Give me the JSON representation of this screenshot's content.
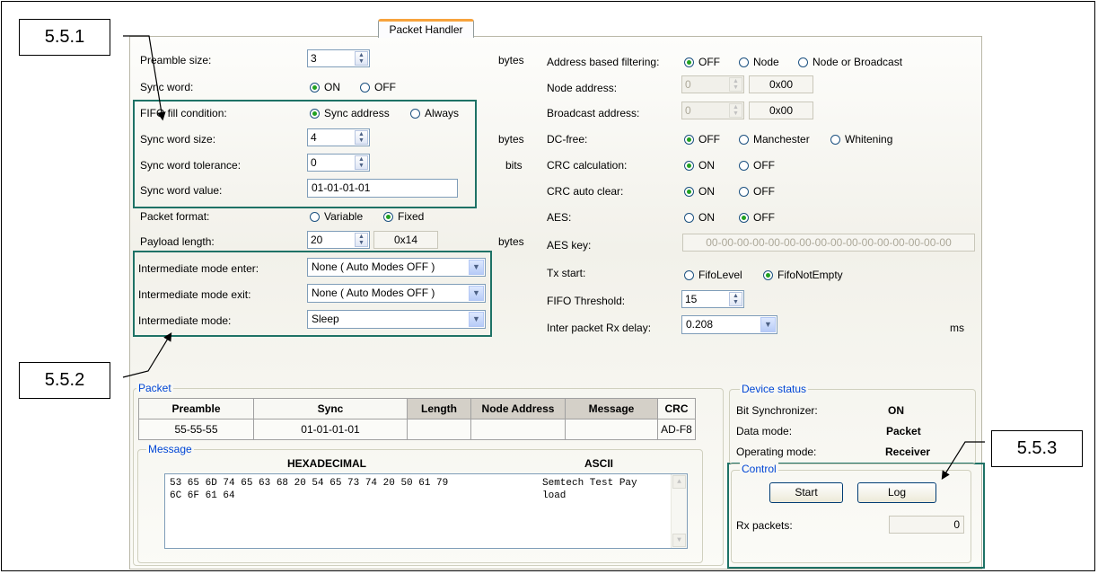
{
  "tab_label": "Packet Handler",
  "callouts": [
    "5.5.1",
    "5.5.2",
    "5.5.3"
  ],
  "left": {
    "preamble_size": {
      "label": "Preamble size:",
      "value": "3",
      "unit": "bytes"
    },
    "sync_word": {
      "label": "Sync word:",
      "on": "ON",
      "off": "OFF",
      "selected": "on"
    },
    "fifo_fill": {
      "label": "FIFO fill condition:",
      "opt1": "Sync address",
      "opt2": "Always"
    },
    "sync_word_size": {
      "label": "Sync word size:",
      "value": "4",
      "unit": "bytes"
    },
    "sync_word_tolerance": {
      "label": "Sync word tolerance:",
      "value": "0",
      "unit": "bits"
    },
    "sync_word_value": {
      "label": "Sync word value:",
      "value": "01-01-01-01"
    },
    "packet_format": {
      "label": "Packet format:",
      "opt1": "Variable",
      "opt2": "Fixed"
    },
    "payload_length": {
      "label": "Payload length:",
      "value": "20",
      "hex": "0x14",
      "unit": "bytes"
    },
    "im_enter": {
      "label": "Intermediate mode enter:",
      "value": "None ( Auto Modes OFF )"
    },
    "im_exit": {
      "label": "Intermediate mode exit:",
      "value": "None ( Auto Modes OFF )"
    },
    "im_mode": {
      "label": "Intermediate  mode:",
      "value": "Sleep"
    }
  },
  "right": {
    "addr_filter": {
      "label": "Address based filtering:",
      "opt1": "OFF",
      "opt2": "Node",
      "opt3": "Node or Broadcast"
    },
    "node_address": {
      "label": "Node address:",
      "value": "0",
      "hex": "0x00"
    },
    "broadcast_address": {
      "label": "Broadcast address:",
      "value": "0",
      "hex": "0x00"
    },
    "dc_free": {
      "label": "DC-free:",
      "opt1": "OFF",
      "opt2": "Manchester",
      "opt3": "Whitening"
    },
    "crc_calc": {
      "label": "CRC calculation:",
      "on": "ON",
      "off": "OFF"
    },
    "crc_clear": {
      "label": "CRC auto clear:",
      "on": "ON",
      "off": "OFF"
    },
    "aes": {
      "label": "AES:",
      "on": "ON",
      "off": "OFF"
    },
    "aes_key": {
      "label": "AES key:",
      "value": "00-00-00-00-00-00-00-00-00-00-00-00-00-00-00-00"
    },
    "tx_start": {
      "label": "Tx start:",
      "opt1": "FifoLevel",
      "opt2": "FifoNotEmpty"
    },
    "fifo_threshold": {
      "label": "FIFO Threshold:",
      "value": "15"
    },
    "rx_delay": {
      "label": "Inter packet Rx delay:",
      "value": "0.208",
      "unit": "ms"
    }
  },
  "packet": {
    "title": "Packet",
    "headers": [
      "Preamble",
      "Sync",
      "Length",
      "Node Address",
      "Message",
      "CRC"
    ],
    "row": [
      "55-55-55",
      "01-01-01-01",
      "",
      "",
      "",
      "AD-F8"
    ]
  },
  "message": {
    "title": "Message",
    "hex_header": "HEXADECIMAL",
    "ascii_header": "ASCII",
    "hex_line1": "53 65 6D 74 65 63 68 20 54 65 73 74 20 50 61 79",
    "hex_line2": "6C 6F 61 64",
    "ascii_line1": "Semtech Test Pay",
    "ascii_line2": "load"
  },
  "device_status": {
    "title": "Device status",
    "bit_sync_label": "Bit Synchronizer:",
    "bit_sync_value": "ON",
    "data_mode_label": "Data mode:",
    "data_mode_value": "Packet",
    "op_mode_label": "Operating mode:",
    "op_mode_value": "Receiver"
  },
  "control": {
    "title": "Control",
    "start": "Start",
    "log": "Log",
    "rx_packets_label": "Rx packets:",
    "rx_packets_value": "0"
  },
  "colors": {
    "highlight": "#1e7266",
    "tab_accent": "#f7a33d",
    "group_title": "#0046d5"
  }
}
